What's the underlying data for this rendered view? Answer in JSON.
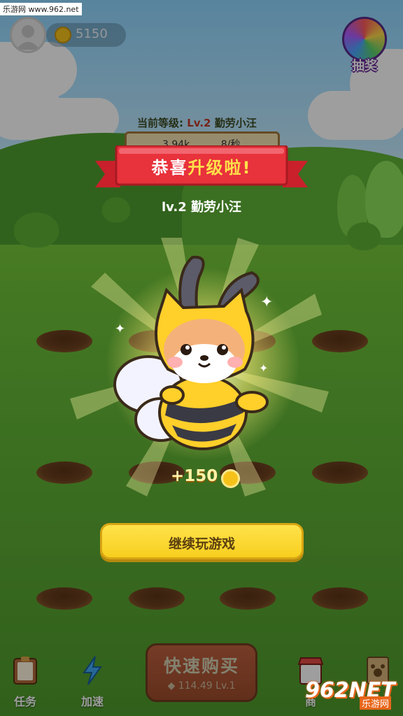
{
  "watermark": {
    "top_text": "乐游网 www.962.net",
    "logo_number": "962NET",
    "logo_chinese": "乐游网"
  },
  "topbar": {
    "coins": "5150",
    "lottery_label": "抽奖"
  },
  "level_panel": {
    "label": "当前等级:",
    "level": "Lv.2",
    "name": "勤劳小汪",
    "rate_value": "3.94k",
    "rate_unit": "8/秒"
  },
  "popup": {
    "title_normal": "恭喜",
    "title_highlight": "升级啦!",
    "subtitle": "lv.2 勤劳小汪",
    "reward": "+150",
    "continue_button": "继续玩游戏"
  },
  "bottom_nav": {
    "tasks": "任务",
    "speed": "加速",
    "buy_title": "快速购买",
    "buy_price": "114.49",
    "buy_level": "Lv.1",
    "shop": "商"
  },
  "colors": {
    "banner_red": "#e8323c",
    "button_yellow": "#f7d22a",
    "title_highlight": "#ffe14a"
  }
}
